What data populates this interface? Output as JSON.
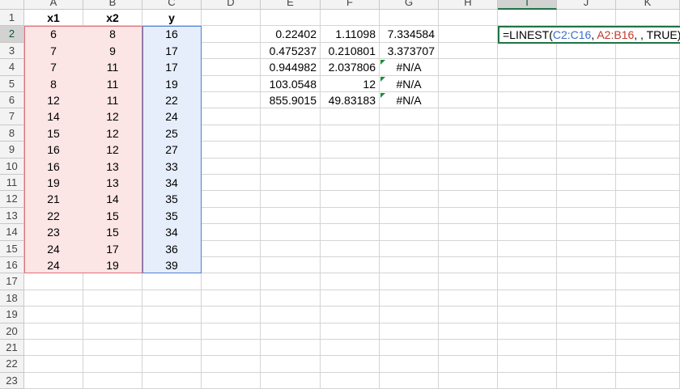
{
  "columns": [
    "A",
    "B",
    "C",
    "D",
    "E",
    "F",
    "G",
    "H",
    "I",
    "J",
    "K"
  ],
  "selected_column": "I",
  "rows": [
    "1",
    "2",
    "3",
    "4",
    "5",
    "6",
    "7",
    "8",
    "9",
    "10",
    "11",
    "12",
    "13",
    "14",
    "15",
    "16",
    "17",
    "18",
    "19",
    "20",
    "21",
    "22",
    "23"
  ],
  "selected_row": "2",
  "headers": {
    "x1": "x1",
    "x2": "x2",
    "y": "y"
  },
  "table": [
    [
      "6",
      "8",
      "16"
    ],
    [
      "7",
      "9",
      "17"
    ],
    [
      "7",
      "11",
      "17"
    ],
    [
      "8",
      "11",
      "19"
    ],
    [
      "12",
      "11",
      "22"
    ],
    [
      "14",
      "12",
      "24"
    ],
    [
      "15",
      "12",
      "25"
    ],
    [
      "16",
      "12",
      "27"
    ],
    [
      "16",
      "13",
      "33"
    ],
    [
      "19",
      "13",
      "34"
    ],
    [
      "21",
      "14",
      "35"
    ],
    [
      "22",
      "15",
      "35"
    ],
    [
      "23",
      "15",
      "34"
    ],
    [
      "24",
      "17",
      "36"
    ],
    [
      "24",
      "19",
      "39"
    ]
  ],
  "linest_output": [
    [
      "0.22402",
      "1.11098",
      "7.334584"
    ],
    [
      "0.475237",
      "0.210801",
      "3.373707"
    ],
    [
      "0.944982",
      "2.037806",
      "#N/A"
    ],
    [
      "103.0548",
      "12",
      "#N/A"
    ],
    [
      "855.9015",
      "49.83183",
      "#N/A"
    ]
  ],
  "formula": {
    "prefix": "=LINEST(",
    "ref_y": "C2:C16",
    "sep": ", ",
    "ref_x": "A2:B16",
    "suffix": ", , TRUE)"
  },
  "colors": {
    "x_range_fill": "#fbe5e5",
    "x_range_border": "#e0707a",
    "y_range_fill": "#e6eefb",
    "y_range_border": "#4d7fd1",
    "accent": "#217346"
  }
}
